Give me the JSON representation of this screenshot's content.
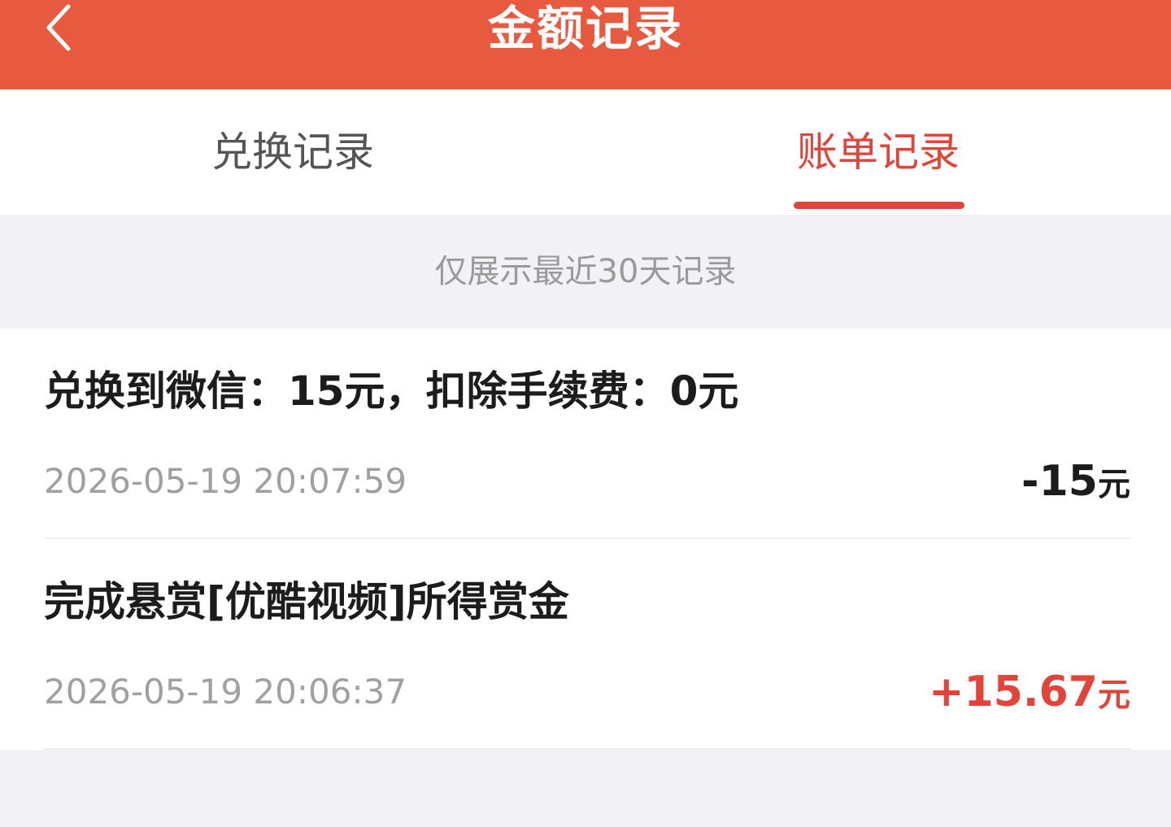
{
  "header": {
    "title": "金额记录",
    "back_icon": "chevron-left-icon",
    "background_color": "#e85a40"
  },
  "tabs": [
    {
      "label": "兑换记录",
      "active": false
    },
    {
      "label": "账单记录",
      "active": true
    }
  ],
  "accent_color": "#e2443a",
  "notice": "仅展示最近30天记录",
  "records": [
    {
      "title": "兑换到微信：15元，扣除手续费：0元",
      "time": "2026-05-19 20:07:59",
      "amount": "-15",
      "unit": "元",
      "amount_color": "#1c1c1c"
    },
    {
      "title": "完成悬赏[优酷视频]所得赏金",
      "time": "2026-05-19 20:06:37",
      "amount": "+15.67",
      "unit": "元",
      "amount_color": "#e2443a"
    }
  ]
}
